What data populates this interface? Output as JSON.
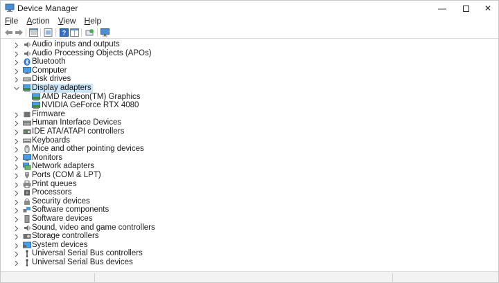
{
  "window": {
    "title": "Device Manager",
    "controls": {
      "minimize": "—",
      "close": "✕"
    }
  },
  "menubar": [
    {
      "key": "F",
      "rest": "ile"
    },
    {
      "key": "A",
      "rest": "ction"
    },
    {
      "key": "V",
      "rest": "iew"
    },
    {
      "key": "H",
      "rest": "elp"
    }
  ],
  "toolbar": {
    "buttons": [
      "back-arrow",
      "forward-arrow",
      "properties-grid",
      "update-driver",
      "help",
      "panel-view",
      "scan-hardware",
      "monitor"
    ]
  },
  "tree": {
    "categories": [
      {
        "label": "Audio inputs and outputs",
        "icon": "speaker-icon",
        "expanded": false
      },
      {
        "label": "Audio Processing Objects (APOs)",
        "icon": "speaker-icon",
        "expanded": false
      },
      {
        "label": "Bluetooth",
        "icon": "bluetooth-icon",
        "expanded": false
      },
      {
        "label": "Computer",
        "icon": "computer-icon",
        "expanded": false
      },
      {
        "label": "Disk drives",
        "icon": "disk-icon",
        "expanded": false
      },
      {
        "label": "Display adapters",
        "icon": "display-adapter-icon",
        "expanded": true,
        "selected": true,
        "children": [
          {
            "label": "AMD Radeon(TM) Graphics",
            "icon": "display-adapter-icon"
          },
          {
            "label": "NVIDIA GeForce RTX 4080",
            "icon": "display-adapter-icon"
          }
        ]
      },
      {
        "label": "Firmware",
        "icon": "firmware-icon",
        "expanded": false
      },
      {
        "label": "Human Interface Devices",
        "icon": "hid-icon",
        "expanded": false
      },
      {
        "label": "IDE ATA/ATAPI controllers",
        "icon": "ide-icon",
        "expanded": false
      },
      {
        "label": "Keyboards",
        "icon": "keyboard-icon",
        "expanded": false
      },
      {
        "label": "Mice and other pointing devices",
        "icon": "mouse-icon",
        "expanded": false
      },
      {
        "label": "Monitors",
        "icon": "monitor-icon",
        "expanded": false
      },
      {
        "label": "Network adapters",
        "icon": "network-icon",
        "expanded": false
      },
      {
        "label": "Ports (COM & LPT)",
        "icon": "port-icon",
        "expanded": false
      },
      {
        "label": "Print queues",
        "icon": "printer-icon",
        "expanded": false
      },
      {
        "label": "Processors",
        "icon": "processor-icon",
        "expanded": false
      },
      {
        "label": "Security devices",
        "icon": "security-icon",
        "expanded": false
      },
      {
        "label": "Software components",
        "icon": "software-component-icon",
        "expanded": false
      },
      {
        "label": "Software devices",
        "icon": "software-device-icon",
        "expanded": false
      },
      {
        "label": "Sound, video and game controllers",
        "icon": "speaker-icon",
        "expanded": false
      },
      {
        "label": "Storage controllers",
        "icon": "storage-icon",
        "expanded": false
      },
      {
        "label": "System devices",
        "icon": "system-icon",
        "expanded": false
      },
      {
        "label": "Universal Serial Bus controllers",
        "icon": "usb-icon",
        "expanded": false
      },
      {
        "label": "Universal Serial Bus devices",
        "icon": "usb-icon",
        "expanded": false
      }
    ]
  },
  "colors": {
    "selection": "#cce4f7",
    "accent": "#0078d4"
  }
}
